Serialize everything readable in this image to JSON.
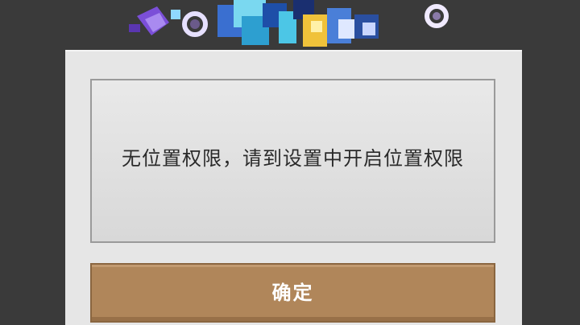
{
  "dialog": {
    "message": "无位置权限，请到设置中开启位置权限",
    "confirm_label": "确定"
  },
  "colors": {
    "background": "#3a3a3a",
    "dialog_bg": "#e6e6e6",
    "button_bg": "#b0865a"
  }
}
